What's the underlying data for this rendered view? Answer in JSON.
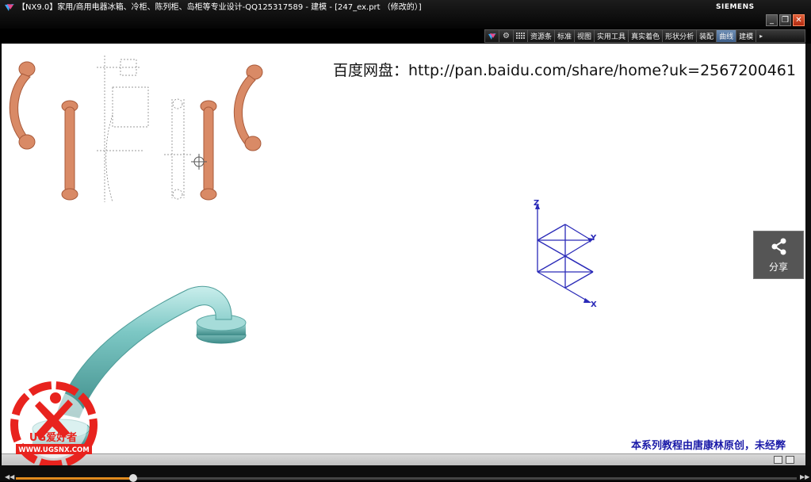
{
  "window": {
    "title": "【NX9.0】家用/商用电器冰箱、冷柜、陈列柜、岛柜等专业设计-QQ125317589 - 建模 - [247_ex.prt （修改的）]",
    "brand": "SIEMENS",
    "controls": {
      "minimize": "_",
      "restore": "❐",
      "close": "✕"
    }
  },
  "ribbon": {
    "icons": [
      "quick-access-icon",
      "gear-icon",
      "grid-icon"
    ],
    "tabs": [
      {
        "label": "资源条",
        "active": false
      },
      {
        "label": "标准",
        "active": false
      },
      {
        "label": "视图",
        "active": false
      },
      {
        "label": "实用工具",
        "active": false
      },
      {
        "label": "真实着色",
        "active": false
      },
      {
        "label": "形状分析",
        "active": false
      },
      {
        "label": "装配",
        "active": false
      },
      {
        "label": "曲线",
        "active": true
      },
      {
        "label": "建模",
        "active": false
      }
    ]
  },
  "viewport": {
    "baidu_link": "百度网盘：http://pan.baidu.com/share/home?uk=2567200461",
    "series_note": "本系列教程由唐康林原创，未经弊",
    "axis_labels": {
      "z": "Z",
      "y": "Y",
      "x": "X"
    },
    "model_color": "#7cc7c4",
    "reference_handle_color": "#d98a66"
  },
  "share_button": {
    "label": "分享"
  },
  "watermark": {
    "logo_text": "UG爱好者",
    "url": "WWW.UGSNX.COM"
  },
  "player": {
    "progress": 0.15
  }
}
